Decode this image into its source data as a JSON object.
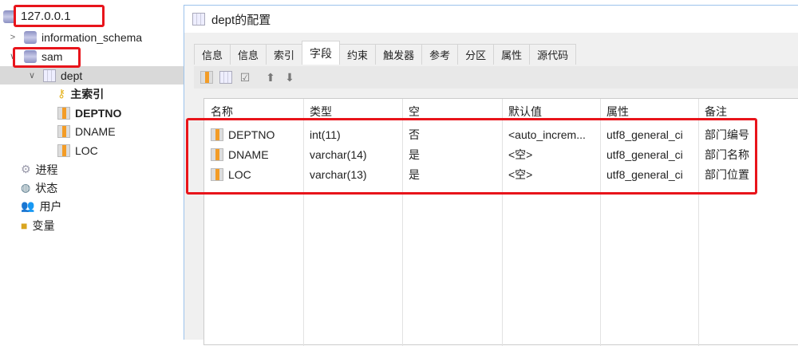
{
  "tree": {
    "server": "127.0.0.1",
    "db1": "information_schema",
    "db2": "sam",
    "table": "dept",
    "primary_index": "主索引",
    "columns": [
      "DEPTNO",
      "DNAME",
      "LOC"
    ],
    "others": [
      {
        "label": "进程",
        "icon": "gears-icon"
      },
      {
        "label": "状态",
        "icon": "globe-icon"
      },
      {
        "label": "用户",
        "icon": "users-icon"
      },
      {
        "label": "变量",
        "icon": "box-icon"
      }
    ]
  },
  "window": {
    "title": "dept的配置",
    "tabs": [
      "信息",
      "信息",
      "索引",
      "字段",
      "约束",
      "触发器",
      "参考",
      "分区",
      "属性",
      "源代码"
    ],
    "active_tab": "字段",
    "grid": {
      "headers": [
        "名称",
        "类型",
        "空",
        "默认值",
        "属性",
        "备注"
      ],
      "rows": [
        [
          "DEPTNO",
          "int(11)",
          "否",
          "<auto_increm...",
          "utf8_general_ci",
          "部门编号"
        ],
        [
          "DNAME",
          "varchar(14)",
          "是",
          "<空>",
          "utf8_general_ci",
          "部门名称"
        ],
        [
          "LOC",
          "varchar(13)",
          "是",
          "<空>",
          "utf8_general_ci",
          "部门位置"
        ]
      ]
    }
  },
  "colors": {
    "highlight": "#e8141b",
    "accent": "#f39c26"
  }
}
